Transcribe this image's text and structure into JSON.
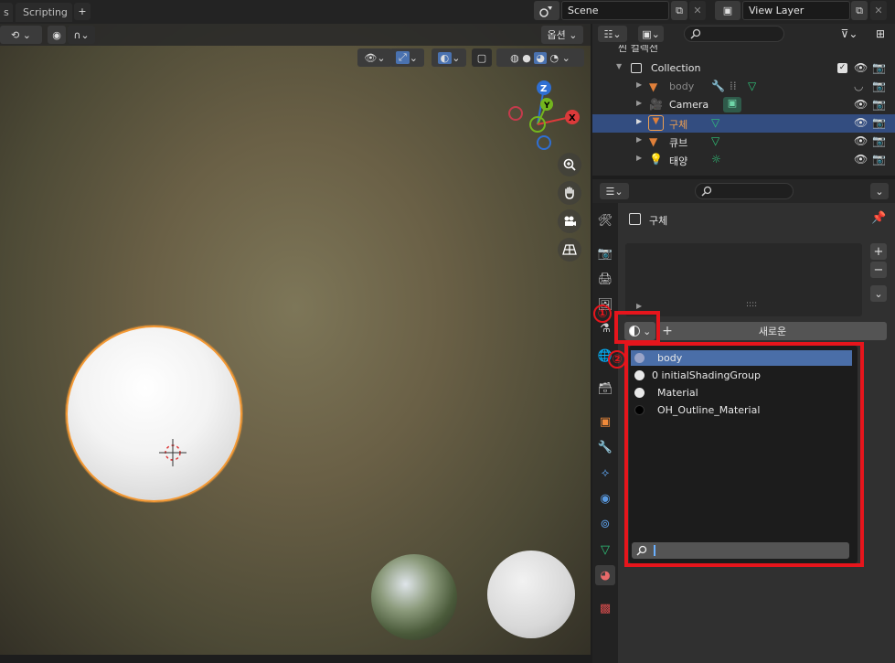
{
  "topbar": {
    "tabs": [
      "s",
      "Scripting"
    ],
    "add_tab": "+",
    "scene_label": "Scene",
    "view_layer_label": "View Layer"
  },
  "viewport": {
    "options_label": "옵션",
    "gizmo_axes": {
      "z": "Z",
      "y": "Y",
      "x": "X"
    }
  },
  "outliner": {
    "scene_collection": "씬 컬렉션",
    "rows": [
      {
        "label": "Collection"
      },
      {
        "label": "body"
      },
      {
        "label": "Camera"
      },
      {
        "label": "구체"
      },
      {
        "label": "큐브"
      },
      {
        "label": "태양"
      }
    ]
  },
  "properties": {
    "object_name": "구체",
    "new_button": "새로운",
    "list_handle": "::::",
    "annotation_1": "①",
    "annotation_2": "②"
  },
  "material_dropdown": {
    "items": [
      {
        "label": "body",
        "color": "#9aa4c8"
      },
      {
        "label": "0 initialShadingGroup",
        "color": "#e8e8e8"
      },
      {
        "label": "Material",
        "color": "#e8e8e8"
      },
      {
        "label": "OH_Outline_Material",
        "color": "#000000"
      }
    ]
  },
  "colors": {
    "selection_orange": "#f59a35",
    "annotation_red": "#e6151c",
    "highlight_blue": "#4a6ea8"
  }
}
